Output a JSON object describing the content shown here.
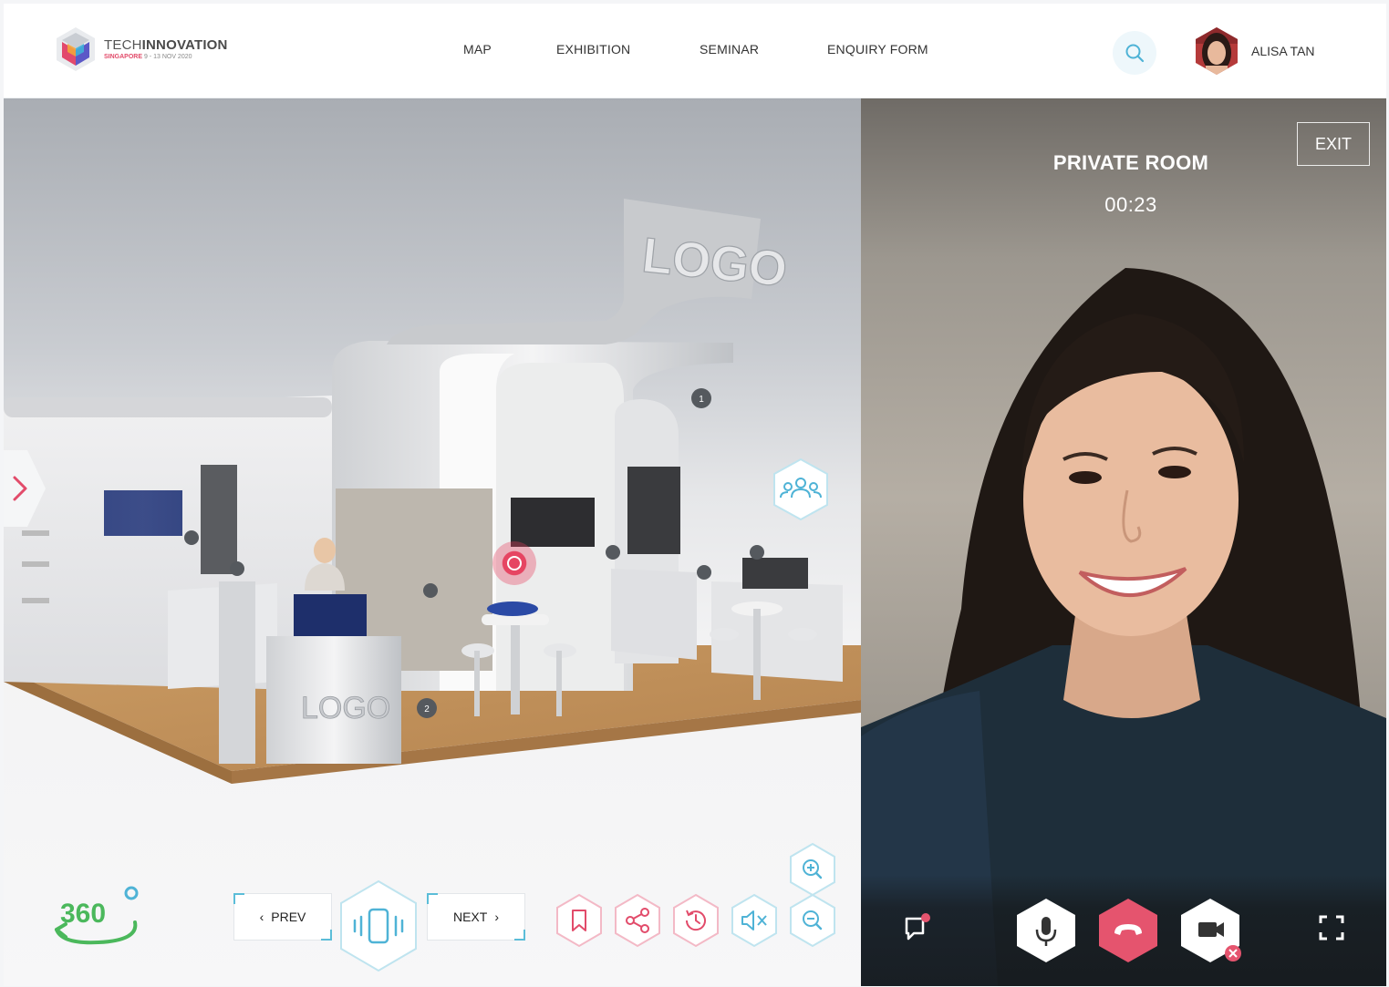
{
  "header": {
    "logo": {
      "name_light": "TECH",
      "name_bold": "INNOVATION",
      "city": "SINGAPORE",
      "dates": "9 - 13 NOV 2020"
    },
    "nav": [
      {
        "label": "MAP"
      },
      {
        "label": "EXHIBITION"
      },
      {
        "label": "SEMINAR"
      },
      {
        "label": "ENQUIRY FORM"
      }
    ],
    "search_icon": "search-icon",
    "user": {
      "name": "ALISA TAN"
    }
  },
  "booth": {
    "sign_logo": "LOGO",
    "counter_logo": "LOGO",
    "hotspot_numbers": [
      "1",
      "2"
    ]
  },
  "toolbar": {
    "badge": "360",
    "prev_label": "PREV",
    "next_label": "NEXT",
    "icons": [
      "bookmark-icon",
      "share-icon",
      "history-icon",
      "mute-icon",
      "zoom-in-icon",
      "zoom-out-icon",
      "device-vibrate-icon"
    ]
  },
  "video_call": {
    "title": "PRIVATE ROOM",
    "timer": "00:23",
    "exit_label": "EXIT",
    "controls": [
      "chat-icon",
      "microphone-icon",
      "hang-up-icon",
      "camera-off-icon",
      "fullscreen-icon"
    ]
  },
  "colors": {
    "accent_teal": "#5bbdd8",
    "accent_pink": "#e24b6a",
    "hangup_red": "#e5546e"
  }
}
